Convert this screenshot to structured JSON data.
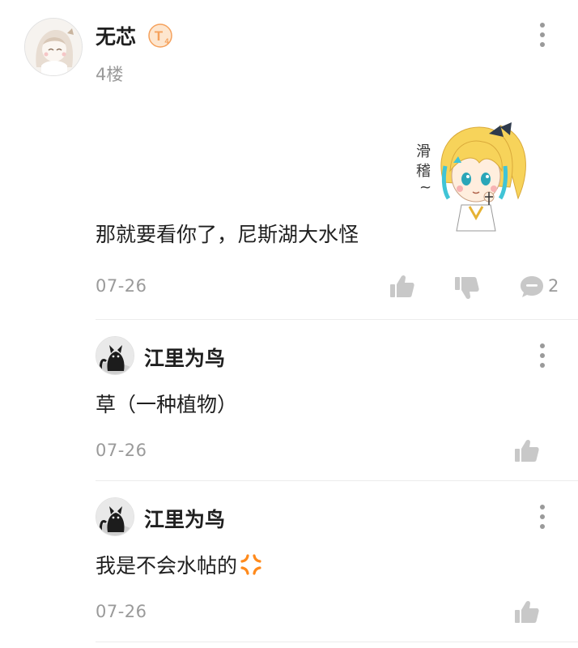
{
  "post": {
    "author": "无芯",
    "level_badge": "T",
    "level_sub": "4",
    "floor": "4楼",
    "sticker_caption": "滑稽~",
    "content": "那就要看你了，尼斯湖大水怪",
    "date": "07-26",
    "reply_count": "2"
  },
  "replies": [
    {
      "author": "江里为鸟",
      "content": "草（一种植物）",
      "date": "07-26"
    },
    {
      "author": "江里为鸟",
      "content": "我是不会水帖的",
      "emoji": "anger-symbol",
      "date": "07-26"
    }
  ],
  "icons": {
    "like": "thumbs-up-icon",
    "dislike": "thumbs-down-icon",
    "comment": "comment-bubble-icon",
    "more": "more-vertical-icon"
  },
  "colors": {
    "icon_gray": "#c8c8c8",
    "badge_orange": "#f5a15c",
    "anger_orange": "#ff8a1c"
  }
}
